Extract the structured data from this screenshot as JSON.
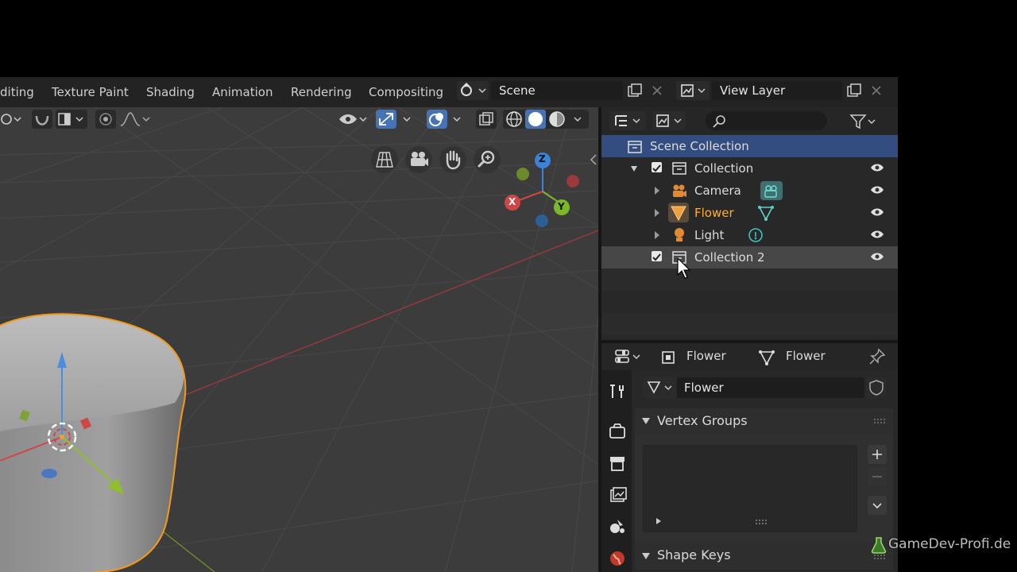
{
  "workspace_tabs": [
    "diting",
    "Texture Paint",
    "Shading",
    "Animation",
    "Rendering",
    "Compositing"
  ],
  "scene": {
    "value": "Scene"
  },
  "view_layer": {
    "value": "View Layer"
  },
  "outliner": {
    "search_placeholder": "",
    "scene_collection": "Scene Collection",
    "items": [
      {
        "label": "Collection",
        "type": "collection"
      },
      {
        "label": "Camera",
        "type": "camera"
      },
      {
        "label": "Flower",
        "type": "mesh",
        "active": true
      },
      {
        "label": "Light",
        "type": "light"
      },
      {
        "label": "Collection 2",
        "type": "collection"
      }
    ]
  },
  "properties": {
    "object_name": "Flower",
    "data_name": "Flower",
    "mesh_field": "Flower",
    "panels": {
      "vertex_groups": "Vertex Groups",
      "shape_keys": "Shape Keys"
    }
  },
  "gizmo": {
    "x": "X",
    "y": "Y",
    "z": "Z"
  },
  "watermark": "GameDev-Profi.de",
  "colors": {
    "accent": "#4772b3",
    "active_object": "#ffaf29",
    "header": "#232323",
    "panel": "#282828"
  }
}
